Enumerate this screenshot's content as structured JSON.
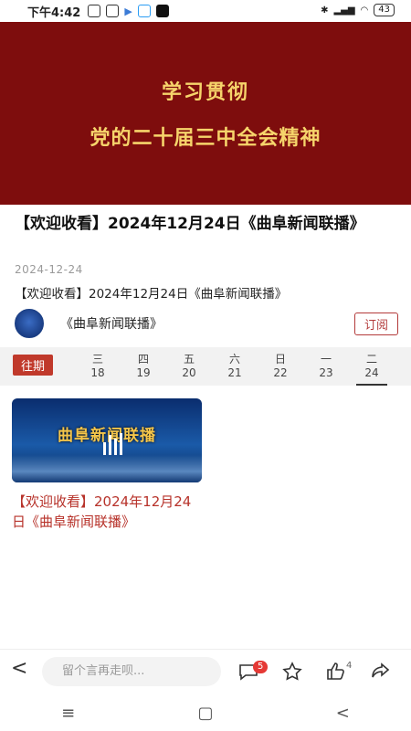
{
  "status_bar": {
    "time": "下午4:42",
    "battery": "43"
  },
  "banner": {
    "line1": "学习贯彻",
    "line2": "党的二十届三中全会精神"
  },
  "article": {
    "title": "【欢迎收看】2024年12月24日《曲阜新闻联播》",
    "date": "2024-12-24",
    "summary": "【欢迎收看】2024年12月24日《曲阜新闻联播》"
  },
  "channel": {
    "name": "《曲阜新闻联播》",
    "subscribe_label": "订阅"
  },
  "week_strip": {
    "past_label": "往期",
    "days": [
      {
        "weekday": "三",
        "date": "18"
      },
      {
        "weekday": "四",
        "date": "19"
      },
      {
        "weekday": "五",
        "date": "20"
      },
      {
        "weekday": "六",
        "date": "21"
      },
      {
        "weekday": "日",
        "date": "22"
      },
      {
        "weekday": "一",
        "date": "23"
      },
      {
        "weekday": "二",
        "date": "24"
      }
    ],
    "selected": "24"
  },
  "video": {
    "thumb_text": "曲阜新闻联播",
    "title": "【欢迎收看】2024年12月24日《曲阜新闻联播》"
  },
  "comment_bar": {
    "placeholder": "留个言再走呗...",
    "comment_count": "5",
    "like_count": "4"
  },
  "colors": {
    "banner": "#7e0d0d",
    "banner_text": "#f6d46b",
    "accent": "#c0392b"
  }
}
